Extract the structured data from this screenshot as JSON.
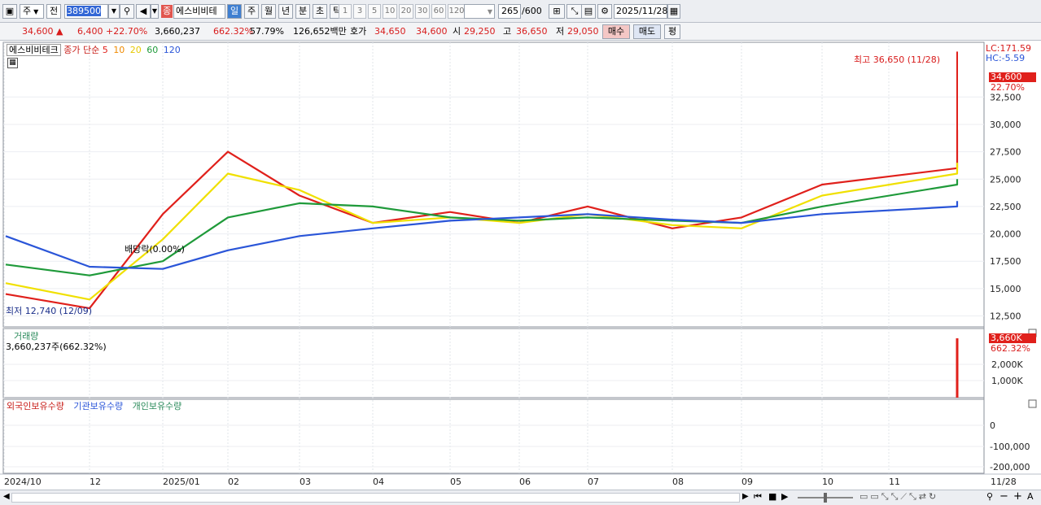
{
  "toolbar": {
    "market_type": "주",
    "market_sub": "전",
    "code": "389500",
    "name_tag": "종",
    "stock_name": "에스비비테",
    "periods": [
      "일",
      "주",
      "월",
      "년",
      "분",
      "초",
      "틱"
    ],
    "active_period": "일",
    "intervals": [
      "1",
      "3",
      "5",
      "10",
      "20",
      "30",
      "60",
      "120"
    ],
    "count": "265",
    "count_max": "/600",
    "date": "2025/11/28"
  },
  "quote": {
    "price": "34,600",
    "change": "6,400",
    "change_pct": "+22.70%",
    "volume": "3,660,237",
    "volume_ratio": "662.32%",
    "turnover": "57.79%",
    "amount": "126,652백만",
    "bid_label": "호가",
    "bid": "34,650",
    "ask": "34,600",
    "open_label": "시",
    "open": "29,250",
    "high_label": "고",
    "high": "36,650",
    "low_label": "저",
    "low": "29,050",
    "buy_label": "매수",
    "sell_label": "매도",
    "avg_label": "평"
  },
  "price_panel": {
    "stock_name": "에스비비테크",
    "indicator_label": "종가 단순",
    "ma_periods": [
      "5",
      "10",
      "20",
      "60",
      "120"
    ],
    "ma_colors": [
      "#e0201b",
      "#f08a00",
      "#f0e000",
      "#1f9a3a",
      "#2a55d8"
    ],
    "lc": "LC:171.59",
    "hc": "HC:-5.59",
    "current_price": "34,600",
    "current_pct": "22.70%",
    "high_annotation": "최고 36,650 (11/28)",
    "low_annotation": "최저 12,740 (12/09)",
    "dividend_annotation": "배당락(0.00%)",
    "y_ticks": [
      "32,500",
      "30,000",
      "27,500",
      "25,000",
      "22,500",
      "20,000",
      "17,500",
      "15,000",
      "12,500"
    ]
  },
  "volume_panel": {
    "title": "거래량",
    "value": "3,660,237주(662.32%)",
    "current": "3,660K",
    "current_pct": "662.32%",
    "y_ticks": [
      "2,000K",
      "1,000K"
    ]
  },
  "holding_panel": {
    "series": [
      {
        "name": "외국인보유수량",
        "color": "#c8201b"
      },
      {
        "name": "기관보유수량",
        "color": "#2a55d8"
      },
      {
        "name": "개인보유수량",
        "color": "#2a8a5a"
      }
    ],
    "y_ticks": [
      "0",
      "-100,000",
      "-200,000"
    ]
  },
  "x_axis": {
    "labels": [
      "2024/10",
      "12",
      "2025/01",
      "02",
      "03",
      "04",
      "05",
      "06",
      "07",
      "08",
      "09",
      "10",
      "11",
      "11/28"
    ]
  },
  "chart_data": {
    "type": "line",
    "title": "",
    "ylabel": "",
    "ylim": [
      11500,
      37500
    ],
    "x": [
      "2024/10",
      "12",
      "2025/01",
      "02",
      "03",
      "04",
      "05",
      "06",
      "07",
      "08",
      "09",
      "10",
      "11",
      "11/28"
    ],
    "series": [
      {
        "name": "5",
        "values": [
          14500,
          13200,
          21800,
          27500,
          23500,
          21000,
          22000,
          21000,
          22500,
          20500,
          21500,
          24500,
          26000,
          29500
        ]
      },
      {
        "name": "20",
        "values": [
          15500,
          14000,
          19500,
          25500,
          24000,
          21000,
          21500,
          21000,
          21800,
          20800,
          20500,
          23500,
          25500,
          26500
        ]
      },
      {
        "name": "60",
        "values": [
          17200,
          16200,
          17500,
          21500,
          22800,
          22500,
          21500,
          21200,
          21500,
          21200,
          21000,
          22500,
          24500,
          25000
        ]
      },
      {
        "name": "120",
        "values": [
          19800,
          17000,
          16800,
          18500,
          19800,
          20500,
          21200,
          21500,
          21800,
          21300,
          21000,
          21800,
          22500,
          23000
        ]
      }
    ]
  }
}
